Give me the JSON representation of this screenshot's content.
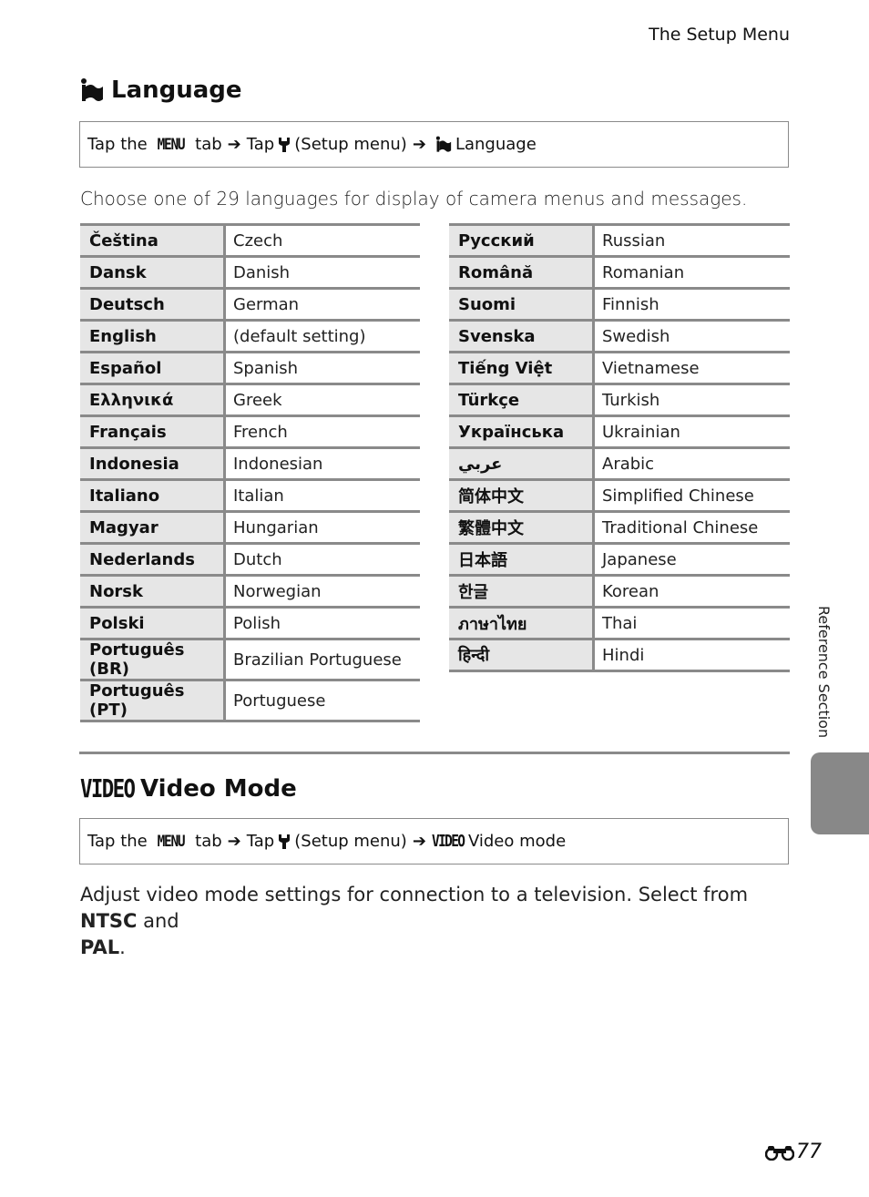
{
  "running_head": "The Setup Menu",
  "language_section": {
    "title": "Language",
    "icon": "language-flag-icon",
    "nav_path": {
      "prefix": "Tap the ",
      "menu_word": "MENU",
      "after_menu": " tab",
      "tap": "Tap",
      "setup_label": "(Setup menu)",
      "target": "Language"
    },
    "intro": "Choose one of 29 languages for display of camera menus and messages.",
    "languages_left": [
      {
        "native": "Čeština",
        "english": "Czech"
      },
      {
        "native": "Dansk",
        "english": "Danish"
      },
      {
        "native": "Deutsch",
        "english": "German"
      },
      {
        "native": "English",
        "english": "(default setting)"
      },
      {
        "native": "Español",
        "english": "Spanish"
      },
      {
        "native": "Ελληνικά",
        "english": "Greek"
      },
      {
        "native": "Français",
        "english": "French"
      },
      {
        "native": "Indonesia",
        "english": "Indonesian"
      },
      {
        "native": "Italiano",
        "english": "Italian"
      },
      {
        "native": "Magyar",
        "english": "Hungarian"
      },
      {
        "native": "Nederlands",
        "english": "Dutch"
      },
      {
        "native": "Norsk",
        "english": "Norwegian"
      },
      {
        "native": "Polski",
        "english": "Polish"
      },
      {
        "native": "Português (BR)",
        "english": "Brazilian Portuguese"
      },
      {
        "native": "Português (PT)",
        "english": "Portuguese"
      }
    ],
    "languages_right": [
      {
        "native": "Русский",
        "english": "Russian"
      },
      {
        "native": "Română",
        "english": "Romanian"
      },
      {
        "native": "Suomi",
        "english": "Finnish"
      },
      {
        "native": "Svenska",
        "english": "Swedish"
      },
      {
        "native": "Tiếng Việt",
        "english": "Vietnamese"
      },
      {
        "native": "Türkçe",
        "english": "Turkish"
      },
      {
        "native": "Українська",
        "english": "Ukrainian"
      },
      {
        "native": "عربي",
        "english": "Arabic"
      },
      {
        "native": "简体中文",
        "english": "Simplified Chinese"
      },
      {
        "native": "繁體中文",
        "english": "Traditional Chinese"
      },
      {
        "native": "日本語",
        "english": "Japanese"
      },
      {
        "native": "한글",
        "english": "Korean"
      },
      {
        "native": "ภาษาไทย",
        "english": "Thai"
      },
      {
        "native": "हिन्दी",
        "english": "Hindi"
      }
    ]
  },
  "video_section": {
    "icon_word": "VIDEO",
    "title": "Video Mode",
    "nav_path": {
      "prefix": "Tap the ",
      "menu_word": "MENU",
      "after_menu": " tab",
      "tap": "Tap",
      "setup_label": "(Setup menu)",
      "target_icon_word": "VIDEO",
      "target": "Video mode"
    },
    "body_before": "Adjust video mode settings for connection to a television. Select from ",
    "option_1": "NTSC",
    "body_middle": " and ",
    "option_2": "PAL",
    "body_end": "."
  },
  "side_tab_label": "Reference Section",
  "page_number": "77",
  "colors": {
    "rule_gray": "#8a8a8a",
    "native_cell_bg": "#e6e6e6",
    "side_tab": "#888888"
  }
}
